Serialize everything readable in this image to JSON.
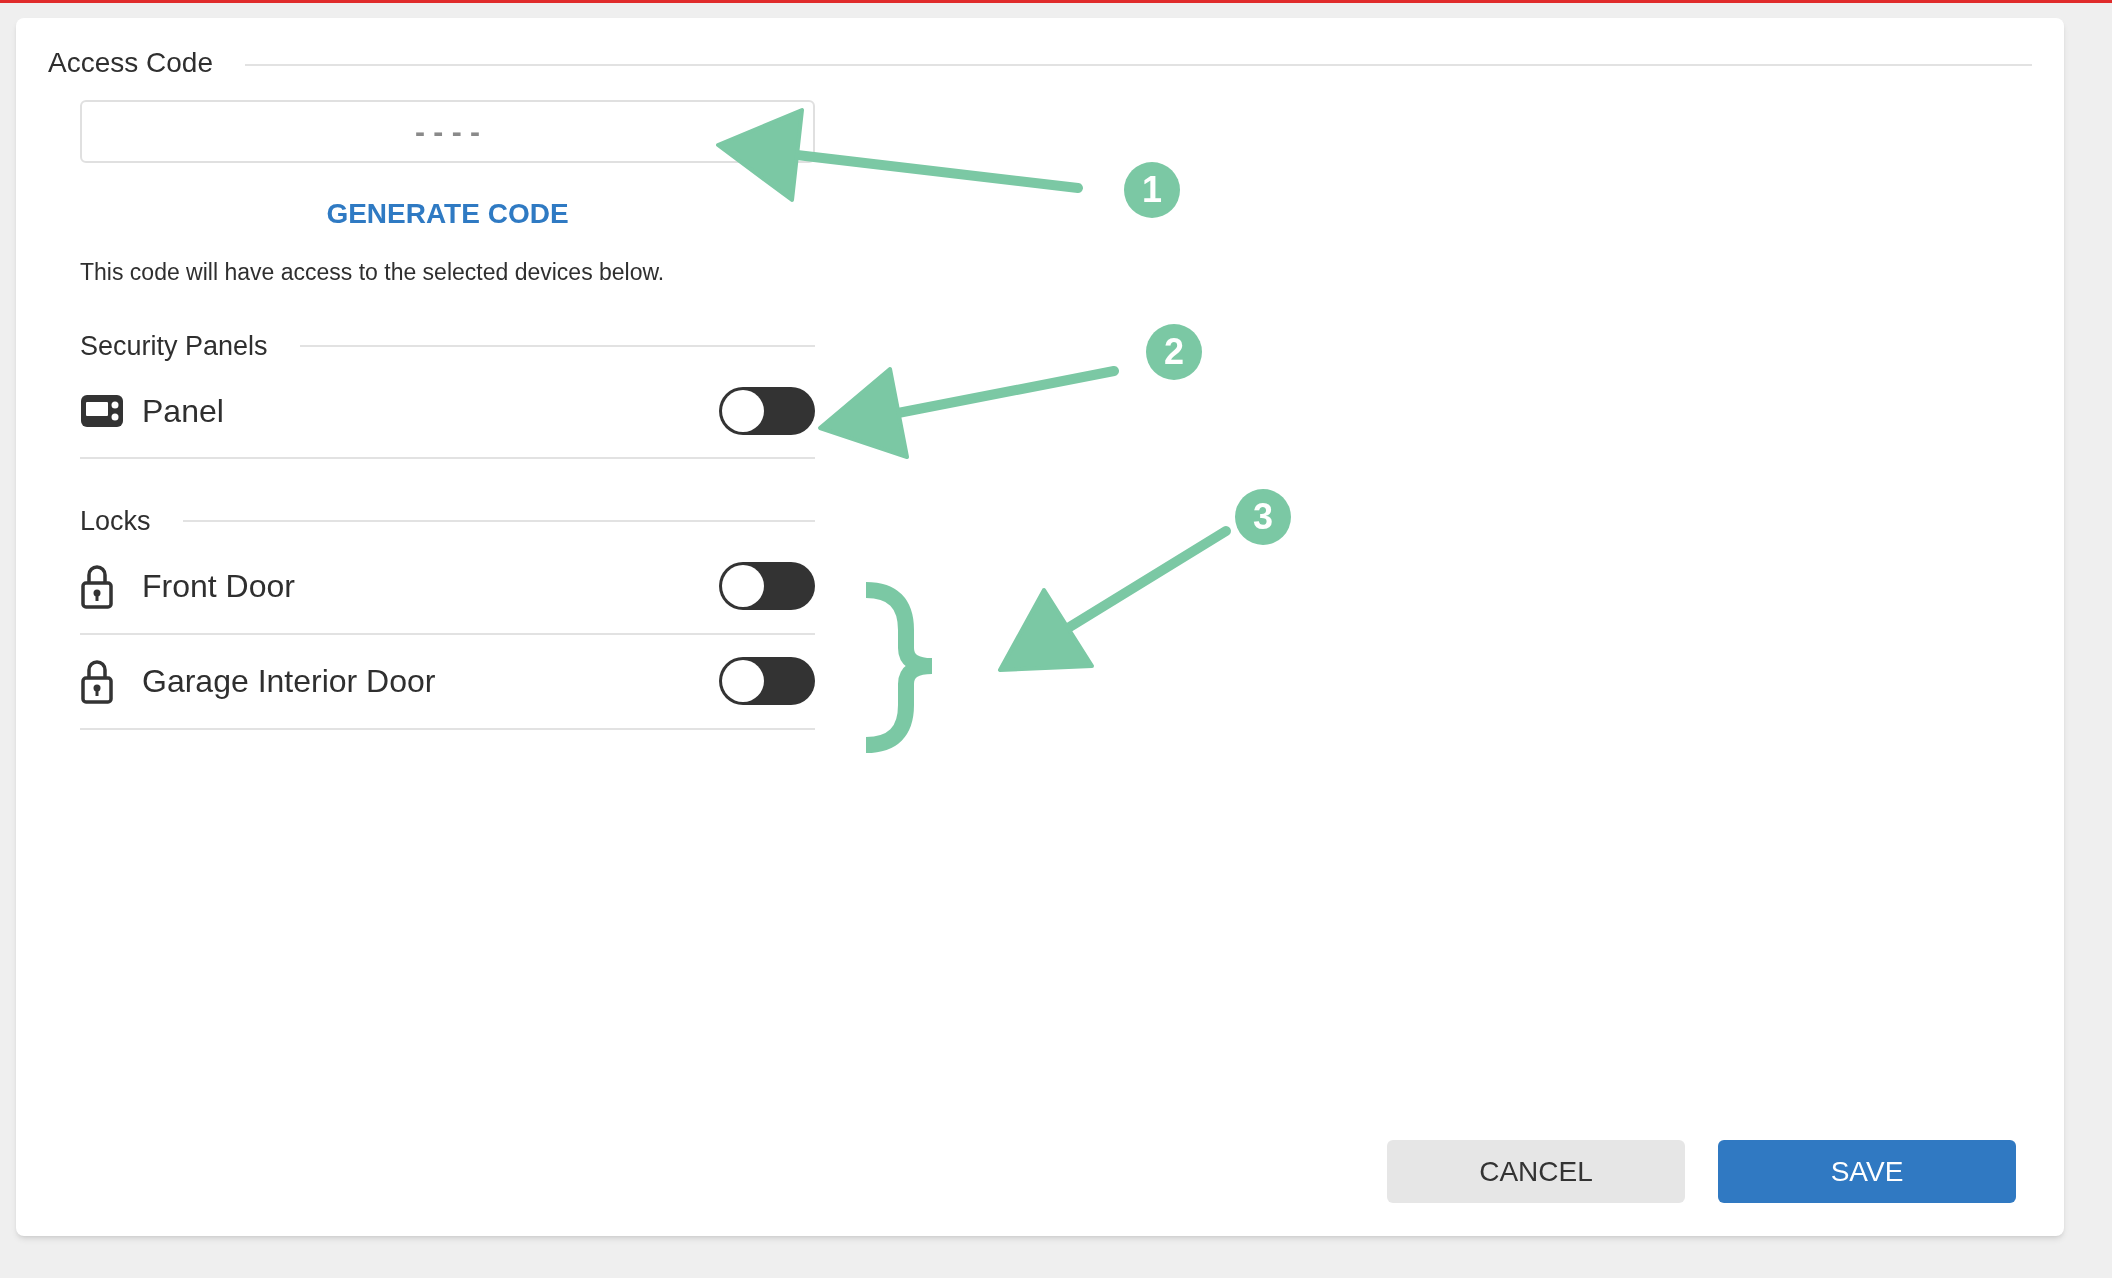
{
  "access_code": {
    "title": "Access Code",
    "field": {
      "placeholder": "- - - -"
    },
    "generate_button": "GENERATE CODE",
    "description": "This code will have access to the selected devices below."
  },
  "groups": [
    {
      "title": "Security Panels",
      "devices": [
        {
          "kind": "panel",
          "name": "Panel",
          "on": false
        }
      ]
    },
    {
      "title": "Locks",
      "devices": [
        {
          "kind": "lock",
          "name": "Front Door",
          "on": false
        },
        {
          "kind": "lock",
          "name": "Garage Interior Door",
          "on": false
        }
      ]
    }
  ],
  "buttons": [
    {
      "kind": "secondary",
      "label": "CANCEL"
    },
    {
      "kind": "primary",
      "label": "SAVE"
    }
  ],
  "annotations": [
    {
      "label": "1"
    },
    {
      "label": "2"
    },
    {
      "label": "3"
    }
  ]
}
